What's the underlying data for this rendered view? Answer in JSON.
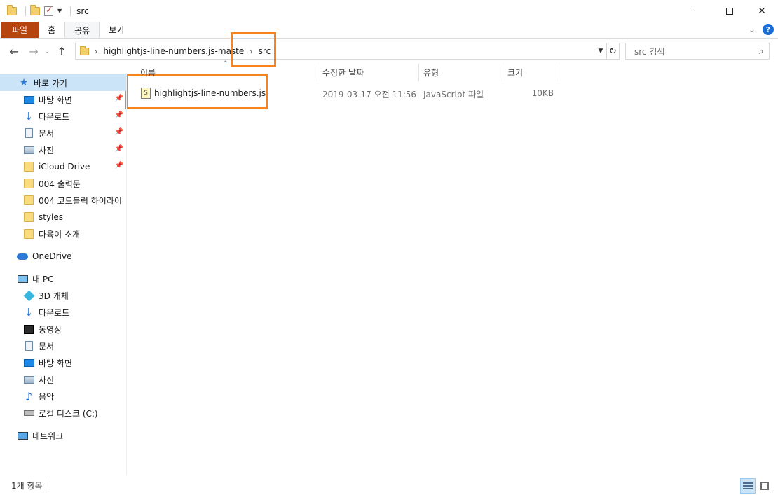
{
  "window": {
    "title": "src",
    "minimize_icon": "minimize-icon",
    "maximize_icon": "maximize-icon",
    "close_label": "✕"
  },
  "ribbon": {
    "tabs": [
      "파일",
      "홈",
      "공유",
      "보기"
    ],
    "active_tab": "공유",
    "help_label": "?"
  },
  "address": {
    "crumbs": [
      "highlightjs-line-numbers.js-maste",
      "src"
    ],
    "search_placeholder": "src 검색"
  },
  "sidebar": {
    "quick_access": {
      "label": "바로 가기",
      "items": [
        {
          "label": "바탕 화면",
          "icon": "desktop-icon",
          "pinned": true
        },
        {
          "label": "다운로드",
          "icon": "download-icon",
          "pinned": true
        },
        {
          "label": "문서",
          "icon": "document-icon",
          "pinned": true
        },
        {
          "label": "사진",
          "icon": "picture-icon",
          "pinned": true
        },
        {
          "label": "iCloud Drive",
          "icon": "folder-icon",
          "pinned": true
        },
        {
          "label": "004 출력문",
          "icon": "folder-icon",
          "pinned": false
        },
        {
          "label": "004 코드블럭 하이라이",
          "icon": "folder-icon",
          "pinned": false
        },
        {
          "label": "styles",
          "icon": "folder-icon",
          "pinned": false
        },
        {
          "label": "다육이 소개",
          "icon": "folder-icon",
          "pinned": false
        }
      ]
    },
    "onedrive": {
      "label": "OneDrive"
    },
    "this_pc": {
      "label": "내 PC",
      "items": [
        {
          "label": "3D 개체",
          "icon": "3d-objects-icon"
        },
        {
          "label": "다운로드",
          "icon": "download-icon"
        },
        {
          "label": "동영상",
          "icon": "video-icon"
        },
        {
          "label": "문서",
          "icon": "document-icon"
        },
        {
          "label": "바탕 화면",
          "icon": "desktop-icon"
        },
        {
          "label": "사진",
          "icon": "picture-icon"
        },
        {
          "label": "음악",
          "icon": "music-icon"
        },
        {
          "label": "로컬 디스크 (C:)",
          "icon": "disk-icon"
        }
      ]
    },
    "network": {
      "label": "네트워크"
    }
  },
  "columns": [
    "이름",
    "수정한 날짜",
    "유형",
    "크기"
  ],
  "files": [
    {
      "name": "highlightjs-line-numbers.js",
      "modified": "2019-03-17 오전 11:56",
      "type": "JavaScript 파일",
      "size": "10KB"
    }
  ],
  "status": {
    "count_text": "1개 항목"
  },
  "colors": {
    "file_tab": "#b6440f",
    "selection": "#cce4f7",
    "highlight_box": "#f5841f"
  }
}
